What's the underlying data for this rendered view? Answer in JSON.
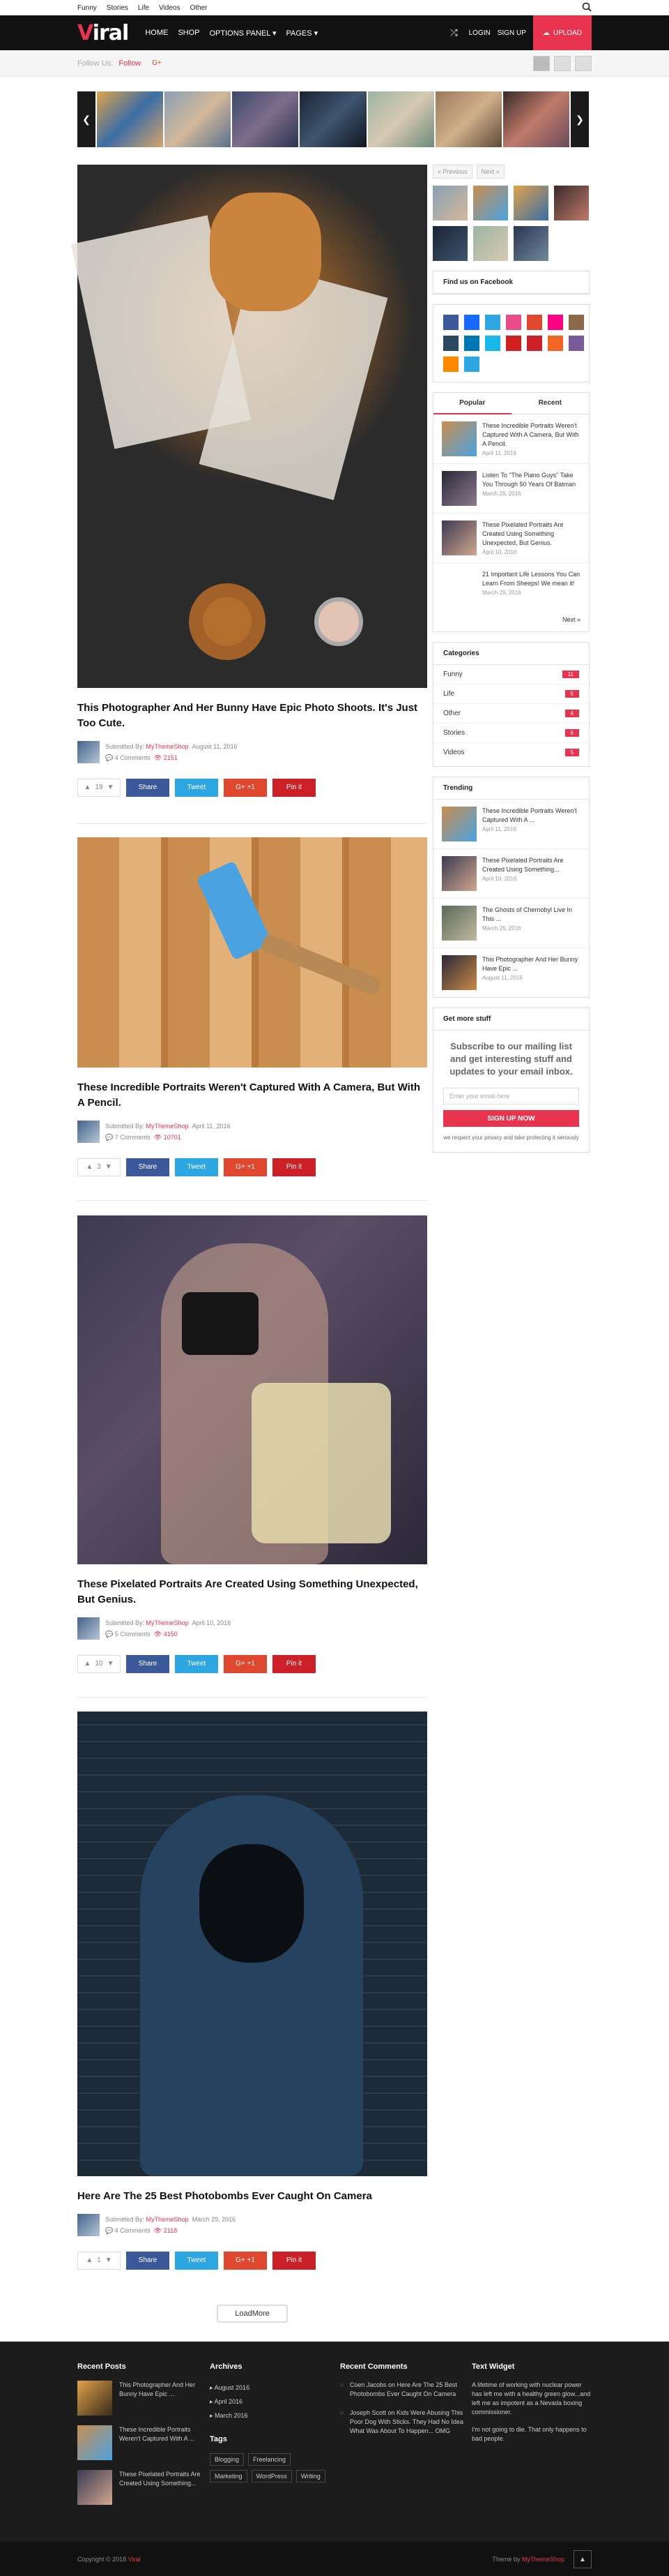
{
  "topbar": {
    "links": [
      "Funny",
      "Stories",
      "Life",
      "Videos",
      "Other"
    ]
  },
  "header": {
    "logo_v": "V",
    "logo_rest": "iral",
    "nav": [
      "HOME",
      "SHOP",
      "OPTIONS PANEL ▾",
      "PAGES ▾"
    ],
    "login": "LOGIN",
    "signup": "SIGN UP",
    "upload": "UPLOAD"
  },
  "subbar": {
    "follow_us": "Follow Us:",
    "follow": "Follow"
  },
  "posts": [
    {
      "title": "This Photographer And Her Bunny Have Epic Photo Shoots. It's Just Too Cute.",
      "submitted": "Submitted By:",
      "author": "MyThemeShop",
      "date": "August 11, 2016",
      "comments": "4 Comments",
      "views": "2151",
      "votes": "19"
    },
    {
      "title": "These Incredible Portraits Weren't Captured With A Camera, But With A Pencil.",
      "submitted": "Submitted By:",
      "author": "MyThemeShop",
      "date": "April 11, 2016",
      "comments": "7 Comments",
      "views": "10701",
      "votes": "3"
    },
    {
      "title": "These Pixelated Portraits Are Created Using Something Unexpected, But Genius.",
      "submitted": "Submitted By:",
      "author": "MyThemeShop",
      "date": "April 10, 2016",
      "comments": "5 Comments",
      "views": "4150",
      "votes": "10"
    },
    {
      "title": "Here Are The 25 Best Photobombs Ever Caught On Camera",
      "submitted": "Submitted By:",
      "author": "MyThemeShop",
      "date": "March 29, 2016",
      "comments": "4 Comments",
      "views": "2118",
      "votes": "1"
    }
  ],
  "share": {
    "facebook": "Share",
    "twitter": "Tweet",
    "gplus": "G+ +1",
    "pinterest": "Pin it"
  },
  "sidebar": {
    "prev": "« Previous",
    "next": "Next »",
    "facebook_title": "Find us on Facebook",
    "tab_popular": "Popular",
    "tab_recent": "Recent",
    "popular": [
      {
        "title": "These Incredible Portraits Weren't Captured With A Camera, But With A Pencil.",
        "date": "April 11, 2016"
      },
      {
        "title": "Listen To \"The Piano Guys\" Take You Through 50 Years Of Batman",
        "date": "March 26, 2016"
      },
      {
        "title": "These Pixelated Portraits Are Created Using Something Unexpected, But Genius.",
        "date": "April 10, 2016"
      },
      {
        "title": "21 Important Life Lessons You Can Learn From Sheeps! We mean it!",
        "date": "March 29, 2016"
      }
    ],
    "popular_next": "Next »",
    "categories_title": "Categories",
    "categories": [
      {
        "name": "Funny",
        "count": "11"
      },
      {
        "name": "Life",
        "count": "5"
      },
      {
        "name": "Other",
        "count": "4"
      },
      {
        "name": "Stories",
        "count": "6"
      },
      {
        "name": "Videos",
        "count": "5"
      }
    ],
    "trending_title": "Trending",
    "trending": [
      {
        "title": "These Incredible Portraits Weren't Captured With A ...",
        "date": "April 11, 2016"
      },
      {
        "title": "These Pixelated Portraits Are Created Using Something...",
        "date": "April 10, 2016"
      },
      {
        "title": "The Ghosts of Chernobyl Live In This ...",
        "date": "March 26, 2016"
      },
      {
        "title": "This Photographer And Her Bunny Have Epic ...",
        "date": "August 11, 2016"
      }
    ],
    "subscribe_title": "Get more stuff",
    "subscribe_text": "Subscribe to our mailing list and get interesting stuff and updates to your email inbox.",
    "email_placeholder": "Enter your email here",
    "signup_btn": "SIGN UP NOW",
    "privacy": "we respect your privacy and take protecting it seriously"
  },
  "loadmore": "LoadMore",
  "footer": {
    "recent_title": "Recent Posts",
    "recent": [
      "This Photographer And Her Bunny Have Epic ...",
      "These Incredible Portraits Weren't Captured With A ...",
      "These Pixelated Portraits Are Created Using Something..."
    ],
    "archives_title": "Archives",
    "archives": [
      "August 2016",
      "April 2016",
      "March 2016"
    ],
    "tags_title": "Tags",
    "tags": [
      "Blogging",
      "Freelancing",
      "Marketing",
      "WordPress",
      "Writing"
    ],
    "comments_title": "Recent Comments",
    "comments": [
      "Coen Jacobs on Here Are The 25 Best Photobombs Ever Caught On Camera",
      "Joseph Scott on Kids Were Abusing This Poor Dog With Sticks. They Had No Idea What Was About To Happen... OMG"
    ],
    "text_title": "Text Widget",
    "text_body": "A lifetime of working with nuclear power has left me with a healthy green glow...and left me as impotent as a Nevada boxing commissioner.",
    "text_body2": "I'm not going to die. That only happens to bad people.",
    "copyright": "Copyright © 2018",
    "copyright_brand": "Viral",
    "theme_by": "Theme by",
    "theme_brand": "MyThemeShop"
  }
}
